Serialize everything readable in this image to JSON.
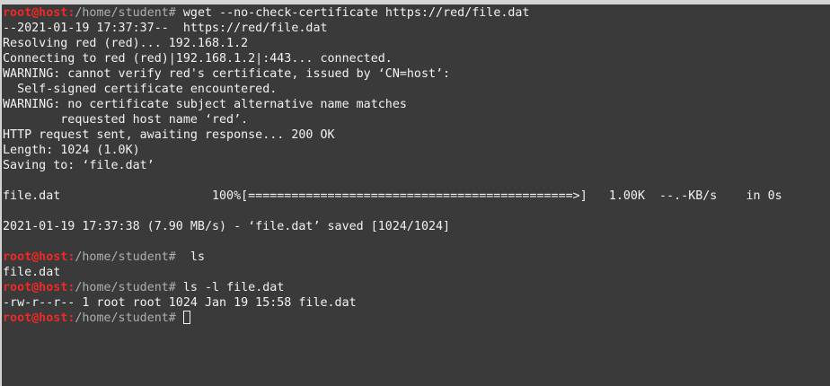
{
  "prompt": {
    "user_host": "root@host",
    "colon": ":",
    "path": "/home/student",
    "symbol": "#"
  },
  "colors": {
    "background": "#3a3a3a",
    "text": "#f2f2f2",
    "prompt_user": "#ef2929",
    "prompt_path": "#9f9f9f"
  },
  "lines": [
    {
      "type": "prompt",
      "command": " wget --no-check-certificate https://red/file.dat"
    },
    {
      "type": "output",
      "text": "--2021-01-19 17:37:37--  https://red/file.dat"
    },
    {
      "type": "output",
      "text": "Resolving red (red)... 192.168.1.2"
    },
    {
      "type": "output",
      "text": "Connecting to red (red)|192.168.1.2|:443... connected."
    },
    {
      "type": "output",
      "text": "WARNING: cannot verify red's certificate, issued by ‘CN=host’:"
    },
    {
      "type": "output",
      "text": "  Self-signed certificate encountered."
    },
    {
      "type": "output",
      "text": "WARNING: no certificate subject alternative name matches"
    },
    {
      "type": "output",
      "text": "        requested host name ‘red’."
    },
    {
      "type": "output",
      "text": "HTTP request sent, awaiting response... 200 OK"
    },
    {
      "type": "output",
      "text": "Length: 1024 (1.0K)"
    },
    {
      "type": "output",
      "text": "Saving to: ‘file.dat’"
    },
    {
      "type": "output",
      "text": ""
    },
    {
      "type": "output",
      "text": "file.dat                     100%[=============================================>]   1.00K  --.-KB/s    in 0s"
    },
    {
      "type": "output",
      "text": ""
    },
    {
      "type": "output",
      "text": "2021-01-19 17:37:38 (7.90 MB/s) - ‘file.dat’ saved [1024/1024]"
    },
    {
      "type": "output",
      "text": ""
    },
    {
      "type": "prompt",
      "command": "  ls"
    },
    {
      "type": "output",
      "text": "file.dat"
    },
    {
      "type": "prompt",
      "command": " ls -l file.dat"
    },
    {
      "type": "output",
      "text": "-rw-r--r-- 1 root root 1024 Jan 19 15:58 file.dat"
    },
    {
      "type": "prompt",
      "command": " ",
      "cursor": true
    }
  ]
}
